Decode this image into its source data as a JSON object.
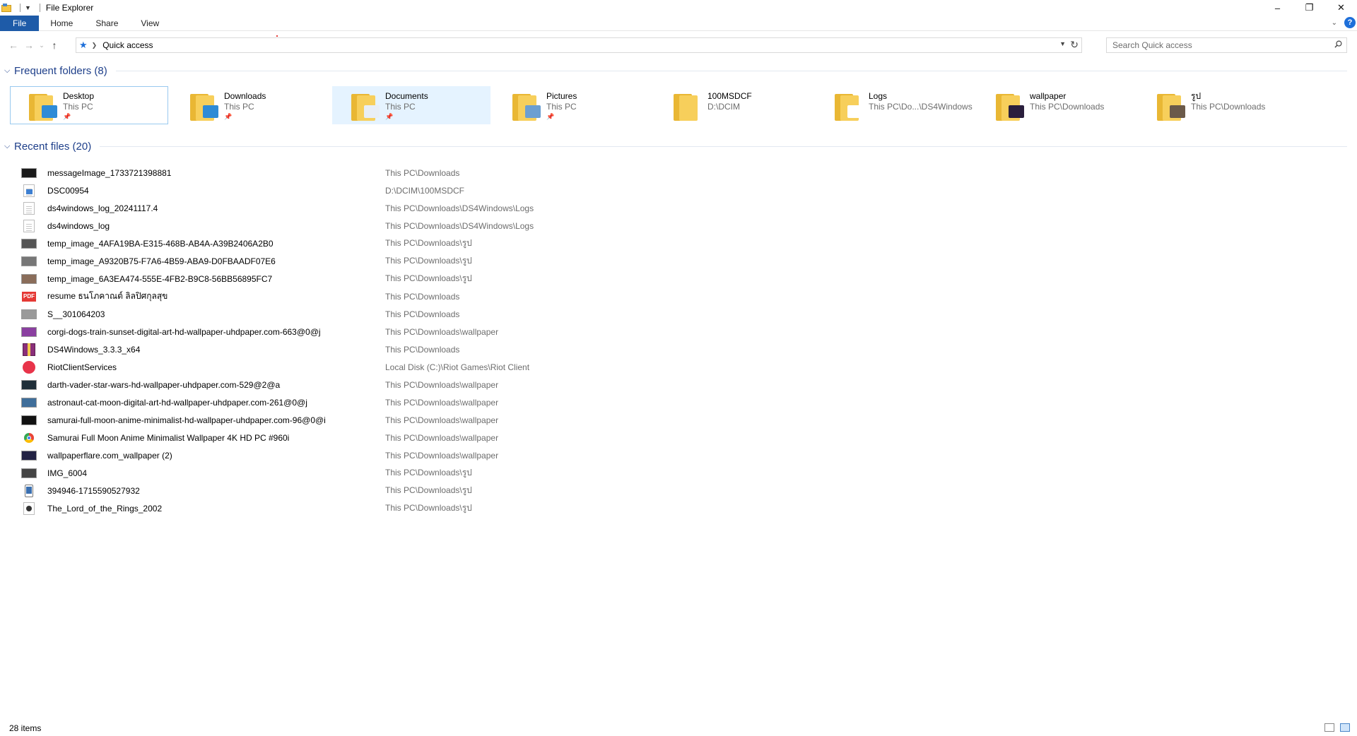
{
  "window": {
    "title": "File Explorer",
    "controls": {
      "minimize": "–",
      "restore": "❐",
      "close": "✕"
    }
  },
  "ribbon": {
    "tabs": [
      {
        "label": "File"
      },
      {
        "label": "Home"
      },
      {
        "label": "Share"
      },
      {
        "label": "View"
      }
    ],
    "help": "?"
  },
  "navigation": {
    "back": "←",
    "forward": "→",
    "recent": "⌄",
    "up": "↑",
    "address": "Quick access",
    "search_placeholder": "Search Quick access"
  },
  "frequent_folders": {
    "title": "Frequent folders (8)",
    "items": [
      {
        "name": "Desktop",
        "location": "This PC",
        "pinned": "📌",
        "badge": "#2e8bd6"
      },
      {
        "name": "Downloads",
        "location": "This PC",
        "pinned": "📌",
        "badge": "#2e8bd6"
      },
      {
        "name": "Documents",
        "location": "This PC",
        "pinned": "📌",
        "badge": "#e8eef6"
      },
      {
        "name": "Pictures",
        "location": "This PC",
        "pinned": "📌",
        "badge": "#6c9fd1"
      },
      {
        "name": "100MSDCF",
        "location": "D:\\DCIM",
        "pinned": "",
        "badge": ""
      },
      {
        "name": "Logs",
        "location": "This PC\\Do...\\DS4Windows",
        "pinned": "",
        "badge": "#ffffff"
      },
      {
        "name": "wallpaper",
        "location": "This PC\\Downloads",
        "pinned": "",
        "badge": "#2a1f3d"
      },
      {
        "name": "รูป",
        "location": "This PC\\Downloads",
        "pinned": "",
        "badge": "#6b5a4a"
      }
    ]
  },
  "recent_files": {
    "title": "Recent files (20)",
    "items": [
      {
        "name": "messageImage_1733721398881",
        "path": "This PC\\Downloads",
        "icon": "image-thumb",
        "color": "#1a1a1a"
      },
      {
        "name": "DSC00954",
        "path": "D:\\DCIM\\100MSDCF",
        "icon": "photo-file",
        "color": "#3d7fd1"
      },
      {
        "name": "ds4windows_log_20241117.4",
        "path": "This PC\\Downloads\\DS4Windows\\Logs",
        "icon": "text-file",
        "color": "#ffffff"
      },
      {
        "name": "ds4windows_log",
        "path": "This PC\\Downloads\\DS4Windows\\Logs",
        "icon": "text-file",
        "color": "#ffffff"
      },
      {
        "name": "temp_image_4AFA19BA-E315-468B-AB4A-A39B2406A2B0",
        "path": "This PC\\Downloads\\รูป",
        "icon": "image-thumb",
        "color": "#555555"
      },
      {
        "name": "temp_image_A9320B75-F7A6-4B59-ABA9-D0FBAADF07E6",
        "path": "This PC\\Downloads\\รูป",
        "icon": "image-thumb",
        "color": "#777777"
      },
      {
        "name": "temp_image_6A3EA474-555E-4FB2-B9C8-56BB56895FC7",
        "path": "This PC\\Downloads\\รูป",
        "icon": "image-thumb",
        "color": "#8a6d5a"
      },
      {
        "name": "resume ธนโภคาณต์ ลิลปิศกุลสุข",
        "path": "This PC\\Downloads",
        "icon": "pdf-file",
        "color": "#e53935",
        "label": "PDF"
      },
      {
        "name": "S__301064203",
        "path": "This PC\\Downloads",
        "icon": "image-thumb",
        "color": "#9a9a9a"
      },
      {
        "name": "corgi-dogs-train-sunset-digital-art-hd-wallpaper-uhdpaper.com-663@0@j",
        "path": "This PC\\Downloads\\wallpaper",
        "icon": "image-thumb",
        "color": "#8a3fa0"
      },
      {
        "name": "DS4Windows_3.3.3_x64",
        "path": "This PC\\Downloads",
        "icon": "archive-file",
        "color": "#8b2f7a"
      },
      {
        "name": "RiotClientServices",
        "path": "Local Disk (C:)\\Riot Games\\Riot Client",
        "icon": "riot-app",
        "color": "#e8344a"
      },
      {
        "name": "darth-vader-star-wars-hd-wallpaper-uhdpaper.com-529@2@a",
        "path": "This PC\\Downloads\\wallpaper",
        "icon": "image-thumb",
        "color": "#1f2e38"
      },
      {
        "name": "astronaut-cat-moon-digital-art-hd-wallpaper-uhdpaper.com-261@0@j",
        "path": "This PC\\Downloads\\wallpaper",
        "icon": "image-thumb",
        "color": "#3f6e9a"
      },
      {
        "name": "samurai-full-moon-anime-minimalist-hd-wallpaper-uhdpaper.com-96@0@i",
        "path": "This PC\\Downloads\\wallpaper",
        "icon": "image-thumb",
        "color": "#111111"
      },
      {
        "name": "Samurai Full Moon Anime Minimalist Wallpaper 4K HD PC #960i",
        "path": "This PC\\Downloads\\wallpaper",
        "icon": "chrome-file",
        "color": "#4285f4"
      },
      {
        "name": "wallpaperflare.com_wallpaper (2)",
        "path": "This PC\\Downloads\\wallpaper",
        "icon": "image-thumb",
        "color": "#222244"
      },
      {
        "name": "IMG_6004",
        "path": "This PC\\Downloads\\รูป",
        "icon": "image-thumb",
        "color": "#444444"
      },
      {
        "name": "394946-1715590527932",
        "path": "This PC\\Downloads\\รูป",
        "icon": "phone-image",
        "color": "#3a6fb0"
      },
      {
        "name": "The_Lord_of_the_Rings_2002",
        "path": "This PC\\Downloads\\รูป",
        "icon": "media-file",
        "color": "#333333"
      }
    ]
  },
  "status": {
    "items_count": "28 items"
  }
}
